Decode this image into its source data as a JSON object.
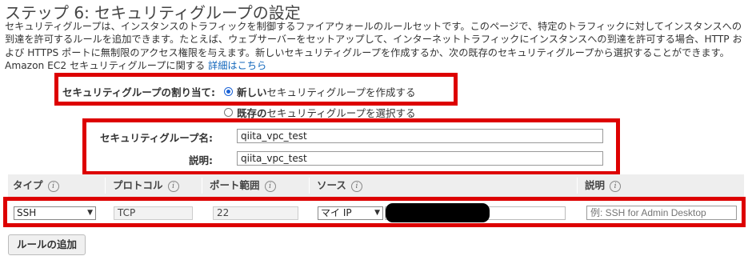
{
  "page": {
    "title": "ステップ 6: セキュリティグループの設定",
    "description": "セキュリティグループは、インスタンスのトラフィックを制御するファイアウォールのルールセットです。このページで、特定のトラフィックに対してインスタンスへの到達を許可するルールを追加できます。たとえば、ウェブサーバーをセットアップして、インターネットトラフィックにインスタンスへの到達を許可する場合、HTTP および HTTPS ポートに無制限のアクセス権限を与えます。新しいセキュリティグループを作成するか、次の既存のセキュリティグループから選択することができます。Amazon EC2 セキュリティグループに関する",
    "description_link": "詳細はこちら"
  },
  "assignment": {
    "label": "セキュリティグループの割り当て:",
    "option_new_bold": "新しい",
    "option_new_rest": "セキュリティグループを作成する",
    "option_existing_bold": "既存の",
    "option_existing_rest": "セキュリティグループを選択する"
  },
  "group_form": {
    "name_label": "セキュリティグループ名:",
    "name_value": "qiita_vpc_test",
    "desc_label": "説明:",
    "desc_value": "qiita_vpc_test"
  },
  "table": {
    "columns": [
      "タイプ",
      "プロトコル",
      "ポート範囲",
      "ソース",
      "説明"
    ],
    "info_glyph": "i",
    "row": {
      "type": "SSH",
      "protocol": "TCP",
      "port_range": "22",
      "source": "マイ IP",
      "description_placeholder": "例: SSH for Admin Desktop"
    }
  },
  "add_rule_button": "ルールの追加",
  "colors": {
    "highlight": "#dd0000",
    "radio_accent": "#1a62d6",
    "link": "#1166bb"
  }
}
